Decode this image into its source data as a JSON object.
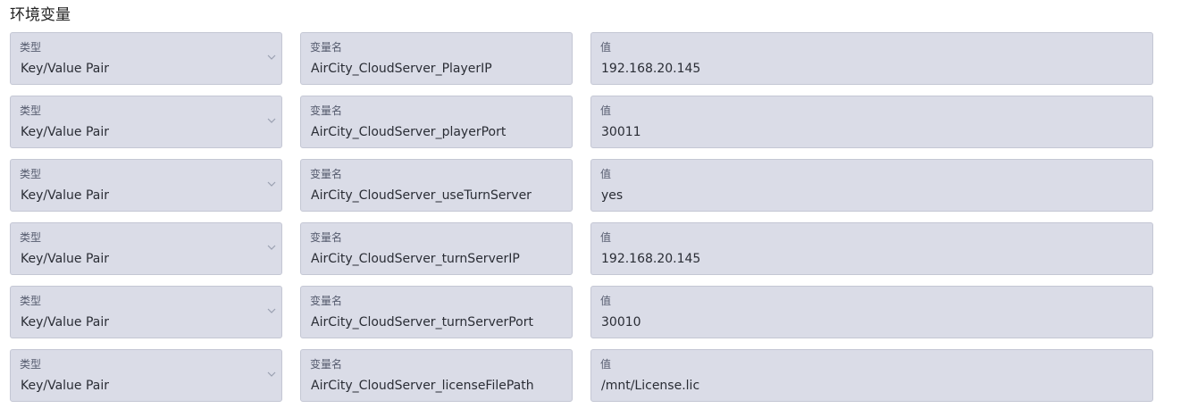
{
  "section": {
    "title": "环境变量"
  },
  "env_vars": [
    {
      "type_label": "类型",
      "type_value": "Key/Value Pair",
      "name_label": "变量名",
      "name_value": "AirCity_CloudServer_PlayerIP",
      "value_label": "值",
      "value_value": "192.168.20.145",
      "chevron_icon": "chevron-down-icon"
    },
    {
      "type_label": "类型",
      "type_value": "Key/Value Pair",
      "name_label": "变量名",
      "name_value": "AirCity_CloudServer_playerPort",
      "value_label": "值",
      "value_value": "30011",
      "chevron_icon": "chevron-down-icon"
    },
    {
      "type_label": "类型",
      "type_value": "Key/Value Pair",
      "name_label": "变量名",
      "name_value": "AirCity_CloudServer_useTurnServer",
      "value_label": "值",
      "value_value": "yes",
      "chevron_icon": "chevron-down-icon"
    },
    {
      "type_label": "类型",
      "type_value": "Key/Value Pair",
      "name_label": "变量名",
      "name_value": "AirCity_CloudServer_turnServerIP",
      "value_label": "值",
      "value_value": "192.168.20.145",
      "chevron_icon": "chevron-down-icon"
    },
    {
      "type_label": "类型",
      "type_value": "Key/Value Pair",
      "name_label": "变量名",
      "name_value": "AirCity_CloudServer_turnServerPort",
      "value_label": "值",
      "value_value": "30010",
      "chevron_icon": "chevron-down-icon"
    },
    {
      "type_label": "类型",
      "type_value": "Key/Value Pair",
      "name_label": "变量名",
      "name_value": "AirCity_CloudServer_licenseFilePath",
      "value_label": "值",
      "value_value": "/mnt/License.lic",
      "chevron_icon": "chevron-down-icon"
    }
  ],
  "colors": {
    "field_background": "#dadce7",
    "field_border": "#c4c7d4",
    "label_text": "#555b6e",
    "value_text": "#2a2d35",
    "chevron": "#9aa0b0"
  }
}
